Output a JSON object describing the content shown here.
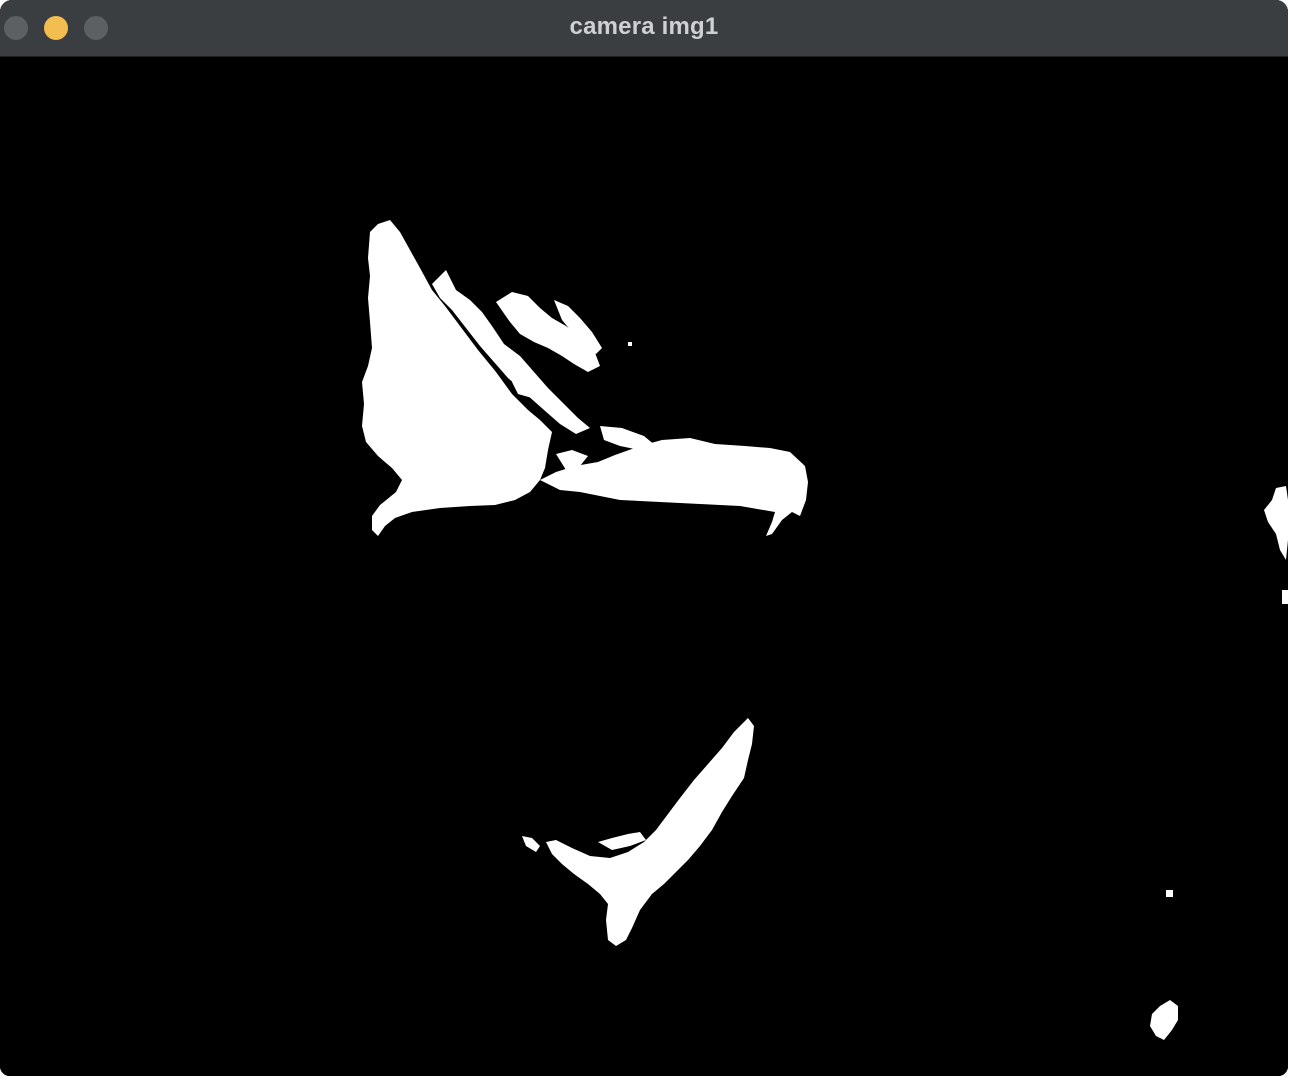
{
  "window": {
    "title": "camera img1",
    "buttons": {
      "close": {
        "color": "#5d6063"
      },
      "minimize": {
        "color": "#f4bd4f"
      },
      "zoom": {
        "color": "#5d6063"
      }
    }
  },
  "image": {
    "description_type": "binary-threshold-mask",
    "foreground": "#ffffff",
    "background": "#000000"
  }
}
